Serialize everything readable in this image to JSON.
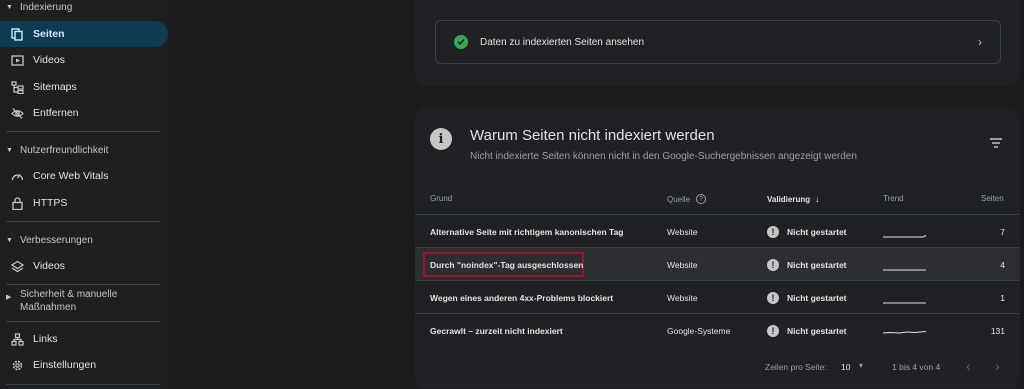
{
  "sidebar": {
    "sections": [
      {
        "label": "Indexierung"
      },
      {
        "label": "Nutzerfreundlichkeit"
      },
      {
        "label": "Verbesserungen"
      },
      {
        "label": "Sicherheit & manuelle Maßnahmen"
      }
    ],
    "items": [
      {
        "label": "Seiten",
        "icon": "pages-icon"
      },
      {
        "label": "Videos",
        "icon": "video-icon"
      },
      {
        "label": "Sitemaps",
        "icon": "sitemap-icon"
      },
      {
        "label": "Entfernen",
        "icon": "hidden-eye-icon"
      },
      {
        "label": "Core Web Vitals",
        "icon": "gauge-icon"
      },
      {
        "label": "HTTPS",
        "icon": "lock-icon"
      },
      {
        "label": "Videos",
        "icon": "layers-icon"
      },
      {
        "label": "Links",
        "icon": "links-icon"
      },
      {
        "label": "Einstellungen",
        "icon": "gear-icon"
      }
    ]
  },
  "top_card": {
    "link_text": "Daten zu indexierten Seiten ansehen"
  },
  "main_card": {
    "title": "Warum Seiten nicht indexiert werden",
    "subtitle": "Nicht indexierte Seiten können nicht in den Google-Suchergebnissen angezeigt werden",
    "headers": {
      "grund": "Grund",
      "quelle": "Quelle",
      "validierung": "Validierung",
      "trend": "Trend",
      "seiten": "Seiten"
    },
    "rows": [
      {
        "grund": "Alternative Seite mit richtigem kanonischen Tag",
        "quelle": "Website",
        "validierung": "Nicht gestartet",
        "seiten": "7"
      },
      {
        "grund": "Durch \"noindex\"-Tag ausgeschlossen",
        "quelle": "Website",
        "validierung": "Nicht gestartet",
        "seiten": "4"
      },
      {
        "grund": "Wegen eines anderen 4xx-Problems blockiert",
        "quelle": "Website",
        "validierung": "Nicht gestartet",
        "seiten": "1"
      },
      {
        "grund": "Gecrawlt – zurzeit nicht indexiert",
        "quelle": "Google-Systeme",
        "validierung": "Nicht gestartet",
        "seiten": "131"
      }
    ],
    "pager": {
      "rows_label": "Zeilen pro Seite:",
      "rows_value": "10",
      "range": "1 bis 4 von 4"
    }
  },
  "colors": {
    "accent_active": "#0e3a52",
    "success": "#34a853",
    "highlight_border": "#a0132b"
  }
}
